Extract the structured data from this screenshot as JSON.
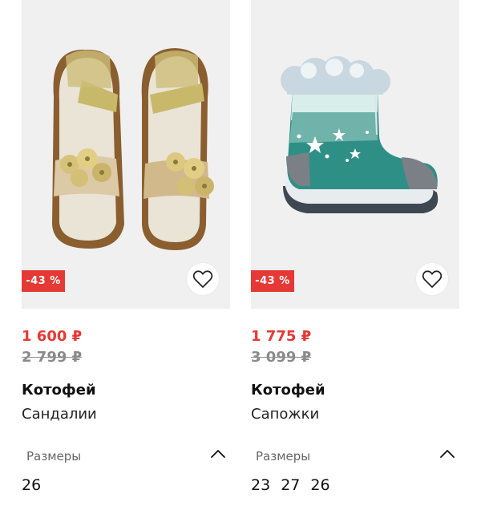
{
  "products": [
    {
      "discount": "-43 %",
      "price": "1 600 ₽",
      "old_price": "2 799 ₽",
      "brand": "Котофей",
      "type": "Сандалии",
      "sizes_label": "Размеры",
      "sizes": [
        "26"
      ],
      "favorite_icon": "heart-outline-icon",
      "toggle_icon": "chevron-up-icon"
    },
    {
      "discount": "-43 %",
      "price": "1 775 ₽",
      "old_price": "3 099 ₽",
      "brand": "Котофей",
      "type": "Сапожки",
      "sizes_label": "Размеры",
      "sizes": [
        "23",
        "27",
        "26"
      ],
      "favorite_icon": "heart-outline-icon",
      "toggle_icon": "chevron-up-icon"
    }
  ],
  "colors": {
    "discount": "#e53935",
    "old_price": "#8a8a8a",
    "photo_bg": "#f1f0f1"
  }
}
